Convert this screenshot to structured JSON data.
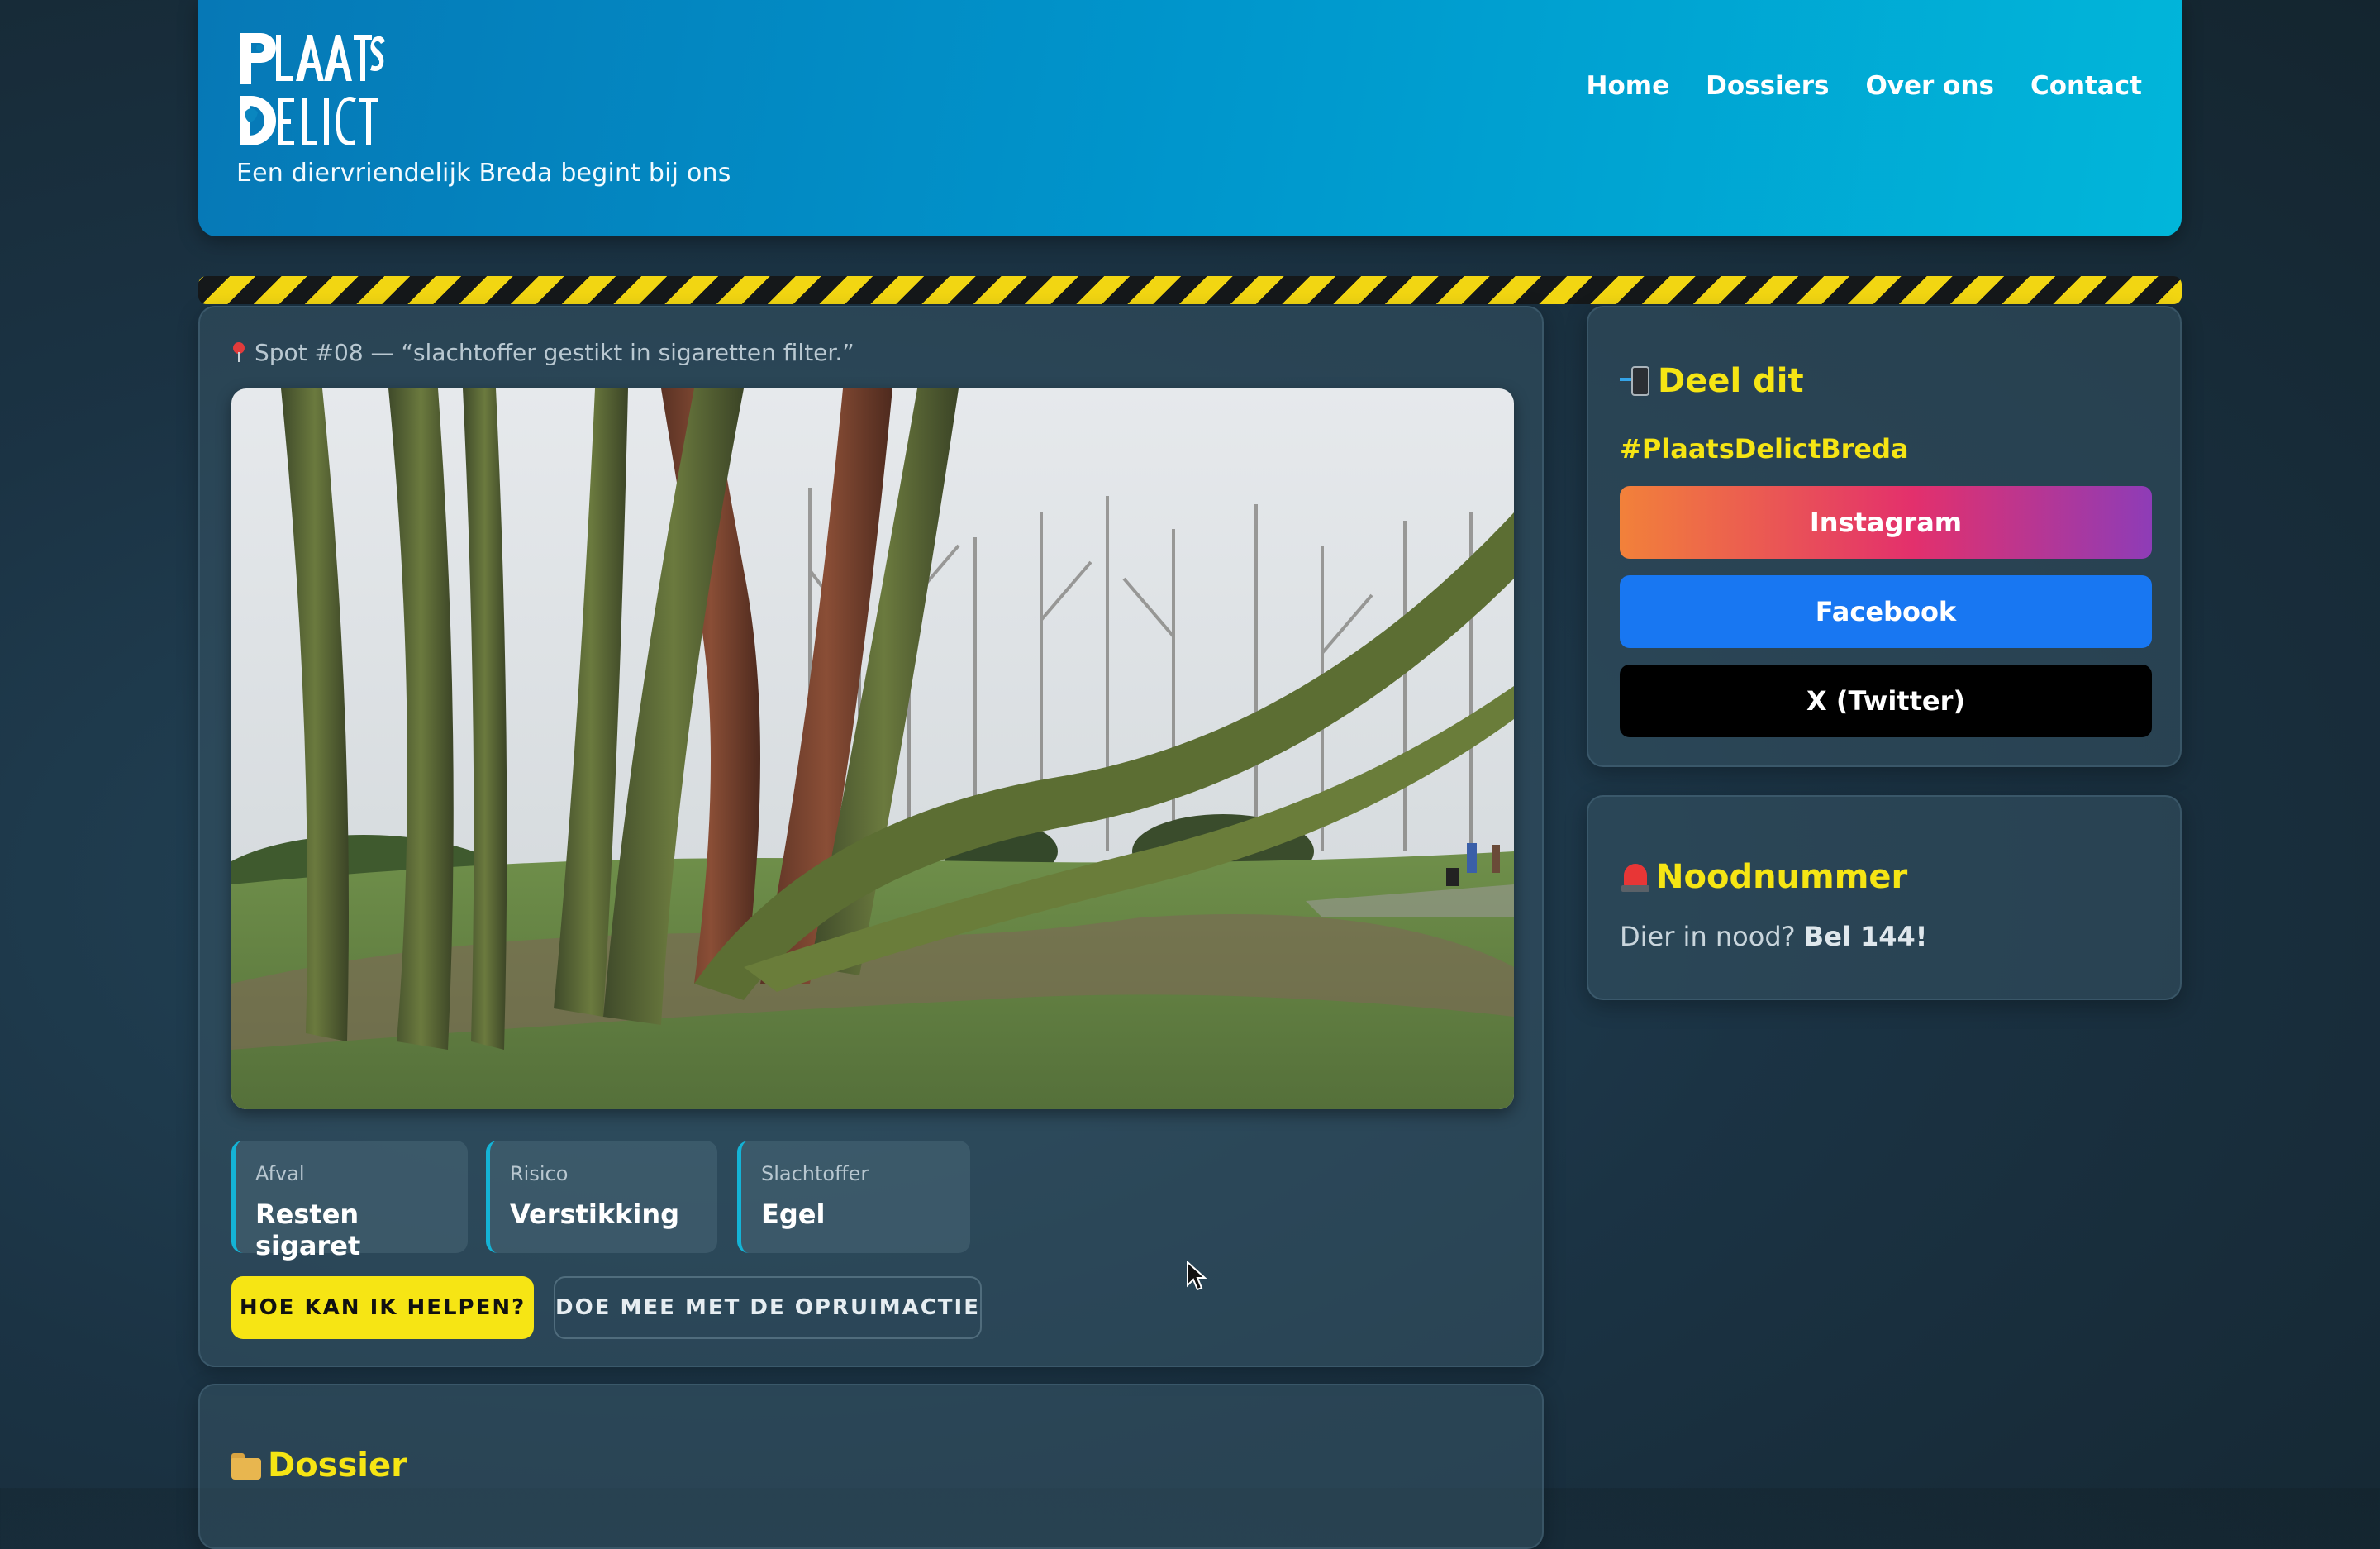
{
  "header": {
    "logo_alt": "Plaats Delict",
    "tagline": "Een diervriendelijk Breda begint bij ons",
    "nav": [
      "Home",
      "Dossiers",
      "Over ons",
      "Contact"
    ]
  },
  "spot": {
    "label": "Spot #08 — “slachtoffer gestikt in sigaretten filter.”",
    "stats": [
      {
        "label": "Afval",
        "value": "Resten sigaret"
      },
      {
        "label": "Risico",
        "value": "Verstikking"
      },
      {
        "label": "Slachtoffer",
        "value": "Egel"
      }
    ],
    "help_button": "HOE KAN IK HELPEN?",
    "join_button": "DOE MEE MET DE OPRUIMACTIE"
  },
  "share": {
    "title": "Deel dit",
    "hashtag": "#PlaatsDelictBreda",
    "instagram": "Instagram",
    "facebook": "Facebook",
    "twitter": "X (Twitter)"
  },
  "emergency": {
    "title": "Noodnummer",
    "prefix": "Dier in nood?",
    "call": "Bel 144!"
  },
  "dossier": {
    "title": "Dossier"
  },
  "colors": {
    "accent_yellow": "#f6e514",
    "header_start": "#0678b6",
    "header_end": "#01b6da",
    "stat_border": "#14b3d6",
    "facebook": "#1877f2",
    "twitter": "#000000"
  }
}
